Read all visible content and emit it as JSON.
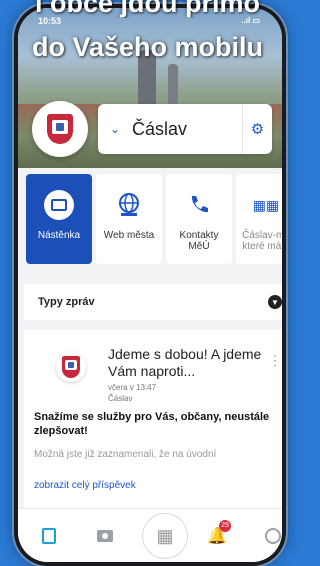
{
  "promo": {
    "line1": "í obce jdou přímo",
    "line2": "do Vašeho mobilu"
  },
  "status": {
    "time": "10:53",
    "signal": "..ıl ▭"
  },
  "header": {
    "city": "Čáslav"
  },
  "tiles": [
    {
      "label": "Nástěnka",
      "icon": "board-icon",
      "active": true
    },
    {
      "label": "Web města",
      "icon": "globe-icon",
      "active": false
    },
    {
      "label": "Kontakty\nMěÚ",
      "icon": "phone-icon",
      "active": false
    },
    {
      "label": "Čáslav-me\nkteré mám",
      "icon": "grid-icon",
      "active": false
    }
  ],
  "feed_filter": {
    "label": "Typy zpráv"
  },
  "post": {
    "title": "Jdeme s dobou! A jdeme Vám naproti...",
    "date": "včera v 13:47",
    "source": "Čáslav",
    "headline": "Snažíme se služby pro Vás, občany, neustále zlepšovat!",
    "excerpt": "Možná jste již zaznamenali, že na úvodní",
    "more_link": "zobrazit celý příspěvek"
  },
  "bottom_nav": {
    "notif_count": "29"
  },
  "colors": {
    "brand_blue": "#1d4fb8",
    "background": "#2a79d3",
    "badge": "#d92b3a"
  }
}
